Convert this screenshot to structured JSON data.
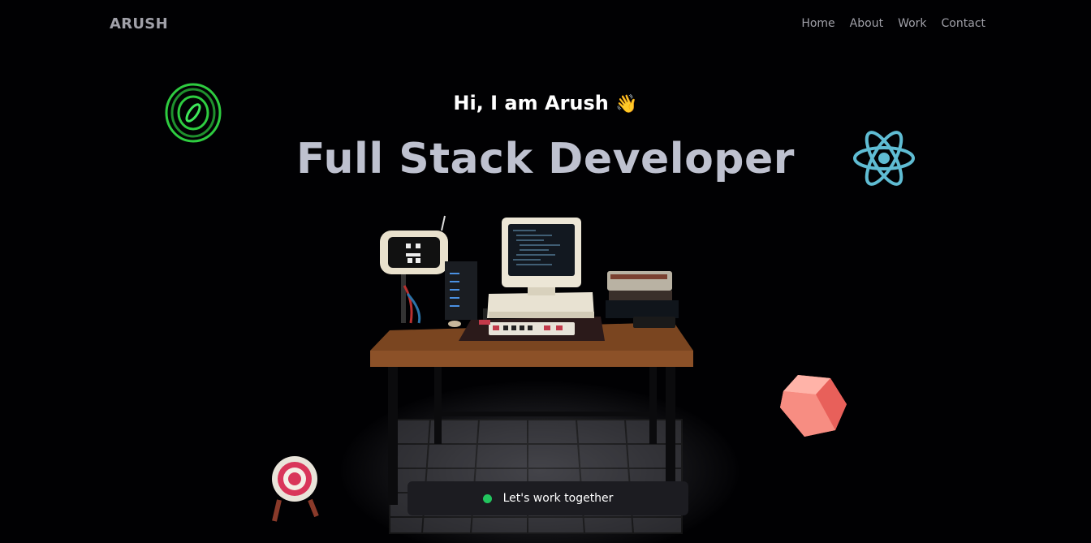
{
  "navbar": {
    "logo": "ARUSH",
    "links": [
      {
        "label": "Home"
      },
      {
        "label": "About"
      },
      {
        "label": "Work"
      },
      {
        "label": "Contact"
      }
    ]
  },
  "hero": {
    "greeting": "Hi, I am Arush",
    "wave_emoji": "👋",
    "headline": "Full Stack Developer"
  },
  "cta": {
    "label": "Let's work together",
    "status_color": "#22c55e"
  },
  "decorations": {
    "icons": [
      "rings-icon",
      "react-logo-icon",
      "cube-icon",
      "target-icon",
      "desk-setup-illustration"
    ]
  },
  "colors": {
    "background": "#010103",
    "headline": "#bec1cf",
    "nav_text": "#a0a0a8",
    "react": "#5fbcd3",
    "rings": "#2ecc40",
    "cube": "#f87c72"
  }
}
